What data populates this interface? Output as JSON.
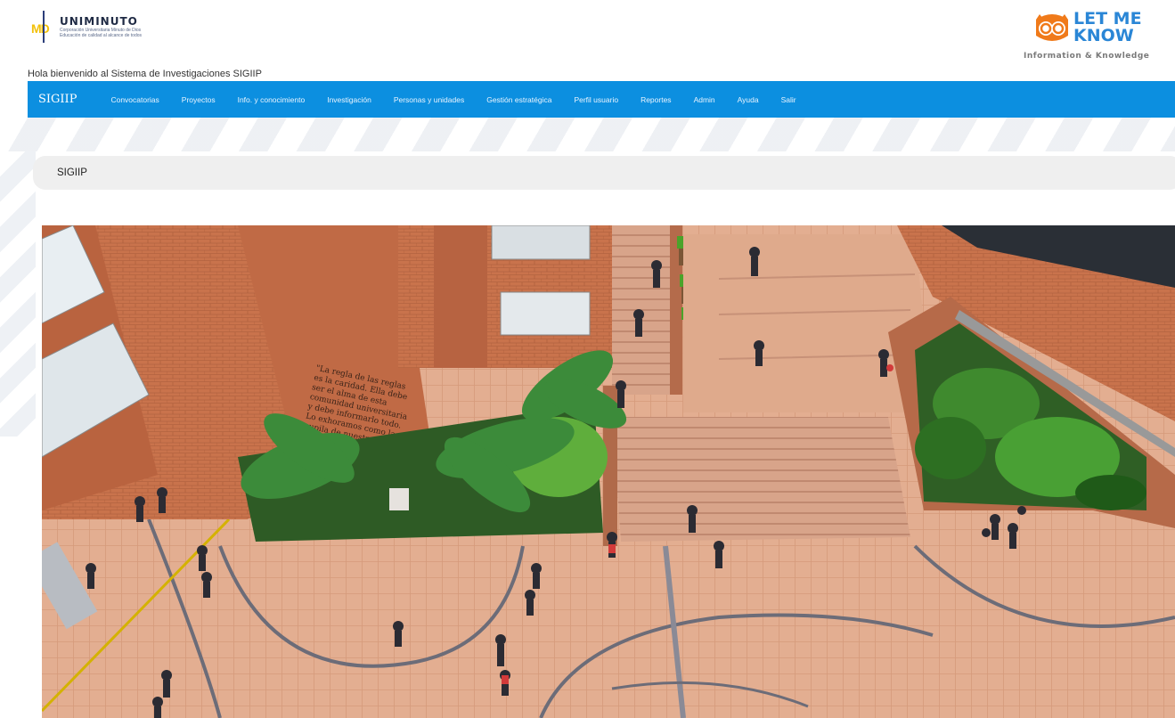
{
  "header": {
    "logo_left": {
      "title": "UNIMINUTO",
      "subtitle_1": "Corporación Universitaria Minuto de Dios",
      "subtitle_2": "Educación de calidad al alcance de todos",
      "mark": "MD"
    },
    "logo_right": {
      "line1": "LET ME",
      "line2": "KNOW",
      "tagline": "Information & Knowledge"
    },
    "welcome": "Hola bienvenido al Sistema de Investigaciones SIGIIP"
  },
  "navbar": {
    "brand": "SIGIIP",
    "items": [
      {
        "label": "Convocatorias"
      },
      {
        "label": "Proyectos"
      },
      {
        "label": "Info. y conocimiento"
      },
      {
        "label": "Investigación"
      },
      {
        "label": "Personas y unidades"
      },
      {
        "label": "Gestión estratégica"
      },
      {
        "label": "Perfil usuario"
      },
      {
        "label": "Reportes"
      },
      {
        "label": "Admin"
      },
      {
        "label": "Ayuda"
      },
      {
        "label": "Salir"
      }
    ],
    "color": "#0c8fe0"
  },
  "breadcrumb": {
    "label": "SIGIIP"
  },
  "hero": {
    "image": "campus-courtyard-photo",
    "wall_quote": "La regla de las reglas es la caridad. Ella debe ser el alma de esta comunidad universitaria y debe informarlo todo. Lo exhoramos como la pupila de nuestros ojos y la mantenemos luminosa en nuestro mismo. P. Rafael García Herreros"
  }
}
